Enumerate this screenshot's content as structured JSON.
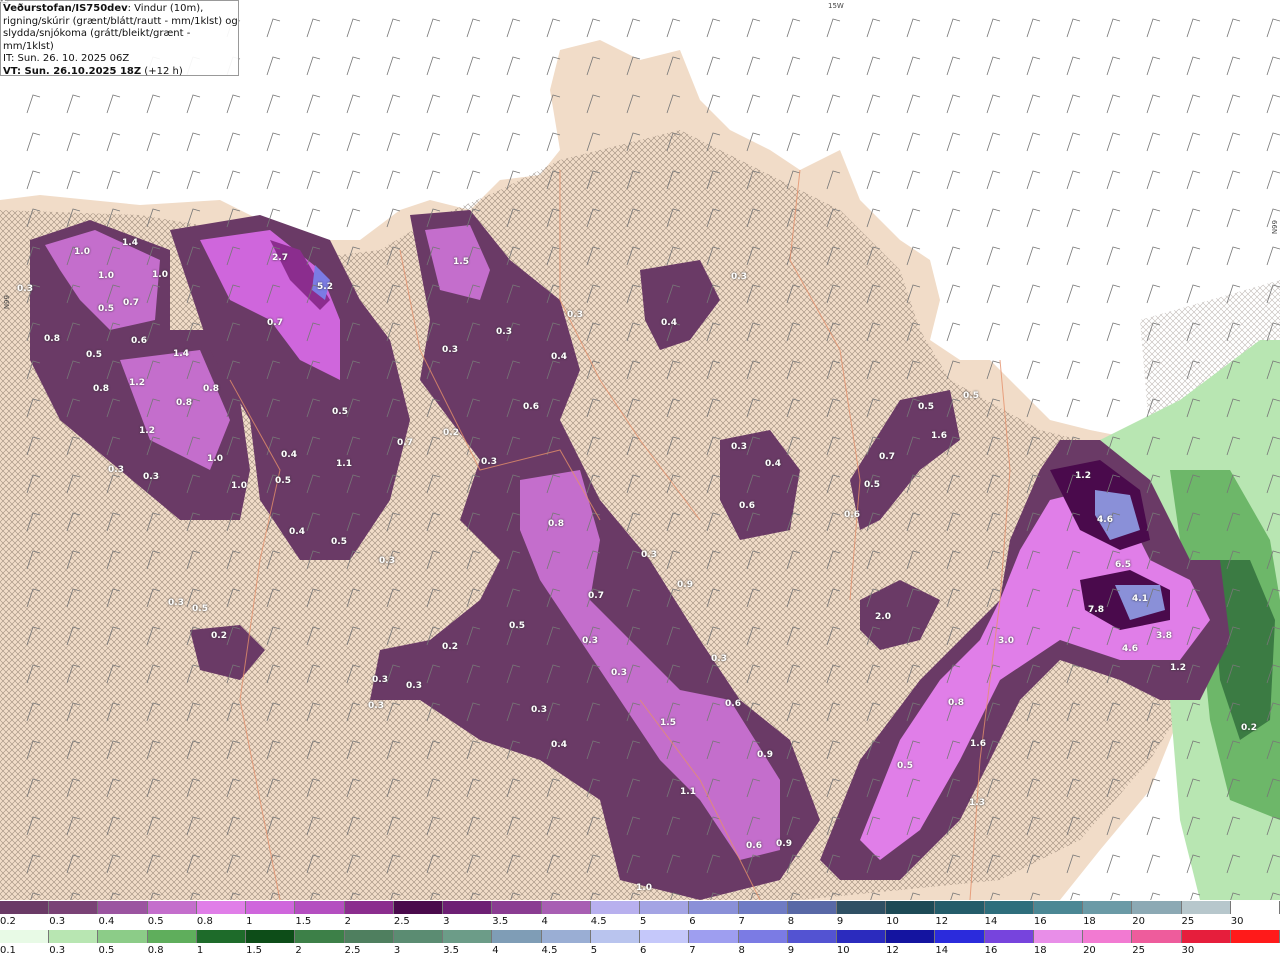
{
  "header": {
    "title_bold": "Veðurstofan/IS750dev",
    "title_rest": ": Vindur (10m),",
    "line2": "rigning/skúrir (grænt/blátt/rautt - mm/1klst) og",
    "line3": "slydda/snjókoma (grátt/bleikt/grænt - mm/1klst)",
    "line4": "IT: Sun. 26. 10. 2025 06Z",
    "line5_bold": "VT: Sun. 26.10.2025 18Z",
    "line5_rest": " (+12 h)"
  },
  "grid_labels": {
    "top": "15W",
    "right": "66N",
    "left": "66N"
  },
  "value_labels": [
    "1.0",
    "1.4",
    "1.0",
    "1.0",
    "0.3",
    "0.5",
    "0.7",
    "0.8",
    "0.5",
    "0.6",
    "0.8",
    "1.2",
    "1.4",
    "0.8",
    "0.8",
    "1.2",
    "1.0",
    "1.0",
    "0.3",
    "0.3",
    "2.7",
    "5.2",
    "0.7",
    "0.5",
    "0.4",
    "0.5",
    "1.1",
    "0.7",
    "0.4",
    "0.5",
    "0.3",
    "1.5",
    "0.3",
    "0.3",
    "0.3",
    "0.4",
    "0.6",
    "0.2",
    "0.3",
    "0.8",
    "0.3",
    "0.4",
    "0.3",
    "0.3",
    "0.4",
    "0.6",
    "0.7",
    "0.5",
    "0.6",
    "0.5",
    "1.6",
    "0.5",
    "1.2",
    "4.6",
    "6.5",
    "4.1",
    "7.8",
    "3.8",
    "4.6",
    "1.2",
    "3.0",
    "2.0",
    "0.8",
    "1.6",
    "0.5",
    "1.3",
    "0.2",
    "0.7",
    "0.9",
    "0.5",
    "0.3",
    "0.2",
    "0.3",
    "0.3",
    "0.3",
    "0.3",
    "0.3",
    "0.4",
    "0.3",
    "1.5",
    "0.6",
    "0.9",
    "1.1",
    "0.6",
    "0.9",
    "1.0",
    "0.2",
    "0.5",
    "0.3",
    "0.2"
  ],
  "legend": {
    "snow_ticks": [
      "0.2",
      "0.3",
      "0.4",
      "0.5",
      "0.8",
      "1",
      "1.5",
      "2",
      "2.5",
      "3",
      "3.5",
      "4",
      "4.5",
      "5",
      "6",
      "7",
      "8",
      "9",
      "10",
      "12",
      "14",
      "16",
      "18",
      "20",
      "25",
      "30"
    ],
    "rain_ticks": [
      "0.1",
      "0.3",
      "0.5",
      "0.8",
      "1",
      "1.5",
      "2",
      "2.5",
      "3",
      "3.5",
      "4",
      "4.5",
      "5",
      "6",
      "7",
      "8",
      "9",
      "10",
      "12",
      "14",
      "16",
      "18",
      "20",
      "25",
      "30"
    ],
    "snow_colors": [
      "#6a3a66",
      "#7a4276",
      "#9b54a0",
      "#c46ecc",
      "#e07ee8",
      "#cf66dc",
      "#b44ec0",
      "#8b2d8e",
      "#4a0a4c",
      "#6d1f74",
      "#8a3c92",
      "#a85fb3",
      "#b8b0ee",
      "#a4a4e4",
      "#8a90d8",
      "#6f7bc4",
      "#5868a6",
      "#2f5064",
      "#1d4a56",
      "#245c6a",
      "#2e6e7c",
      "#4b8794",
      "#6b9aa6",
      "#8ca9b4",
      "#b7c7cc",
      "#ffffff"
    ],
    "rain_colors": [
      "#e8fae6",
      "#b8e6b2",
      "#8ccc88",
      "#5fae5c",
      "#1e6b2a",
      "#0d4d18",
      "#3d8048",
      "#4f7f5f",
      "#5b8c72",
      "#6c9c88",
      "#7f9db6",
      "#9aaed4",
      "#b9c4ee",
      "#c5c8fa",
      "#9e9ef0",
      "#7b7be4",
      "#5353d2",
      "#2b2bbe",
      "#1414a0",
      "#2b2bdc",
      "#7744dd",
      "#e88ee8",
      "#f27ad2",
      "#ee5c9c",
      "#e61e3c",
      "#ff1a1a"
    ]
  }
}
